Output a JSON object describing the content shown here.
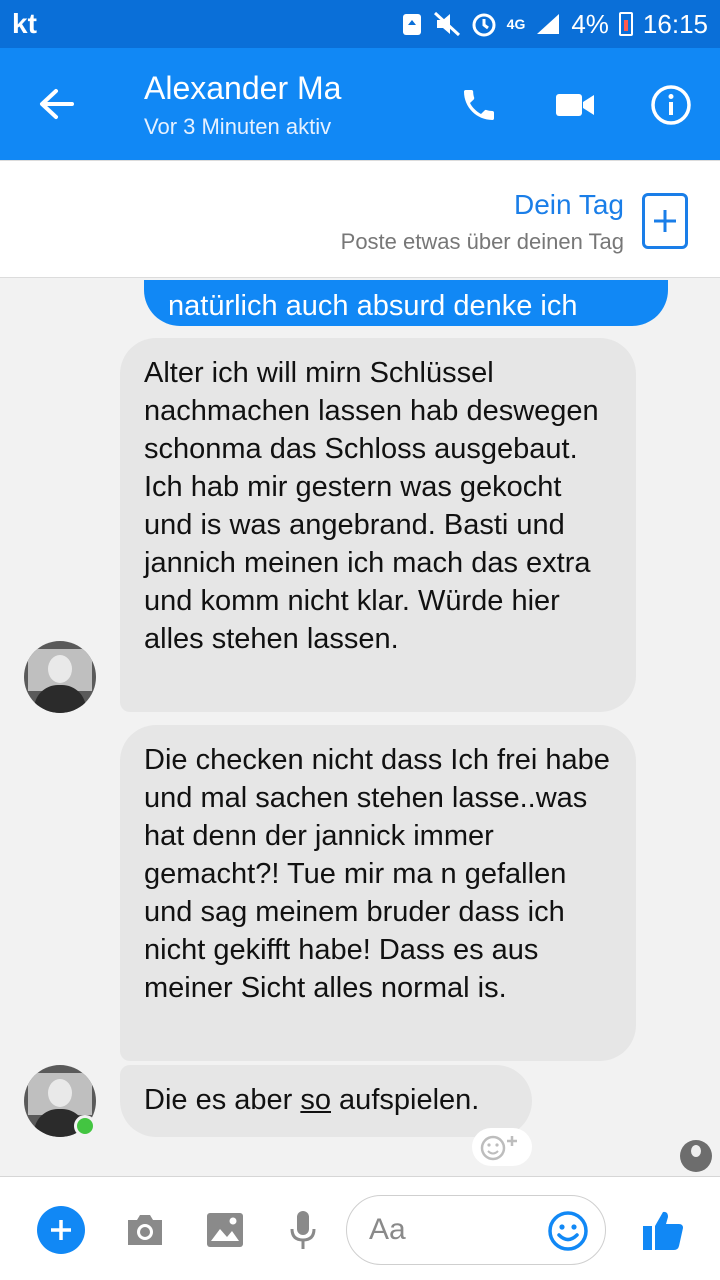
{
  "status_bar": {
    "carrier": "kt",
    "network": "4G",
    "battery": "4%",
    "time": "16:15"
  },
  "header": {
    "contact_name": "Alexander Ma",
    "contact_status": "Vor 3 Minuten aktiv",
    "icons": [
      "back-arrow-icon",
      "phone-icon",
      "video-camera-icon",
      "info-icon"
    ]
  },
  "day_banner": {
    "title": "Dein Tag",
    "subtitle": "Poste etwas über deinen Tag"
  },
  "messages": {
    "outgoing_partial": "natürlich auch absurd denke ich",
    "incoming_1": "Alter ich will mirn Schlüssel nachmachen lassen hab deswegen schonma das Schloss ausgebaut. Ich hab mir gestern was gekocht und is was angebrand. Basti und jannich meinen ich mach das extra und komm nicht klar. Würde hier alles stehen lassen.",
    "incoming_2": "Die checken nicht dass Ich frei habe und mal sachen stehen lasse..was hat denn der jannick immer gemacht?! Tue mir ma n gefallen und sag meinem bruder dass ich nicht gekifft habe! Dass es aus meiner Sicht alles normal is.",
    "incoming_3_before": "Die es aber ",
    "incoming_3_underlined": "so",
    "incoming_3_after": " aufspielen."
  },
  "composer": {
    "placeholder": "Aa",
    "value": ""
  },
  "colors": {
    "status_bar": "#0a6fd8",
    "header": "#1188f5",
    "accent": "#1a7ee8",
    "incoming_bubble": "#e6e6e6",
    "online": "#43c541"
  }
}
